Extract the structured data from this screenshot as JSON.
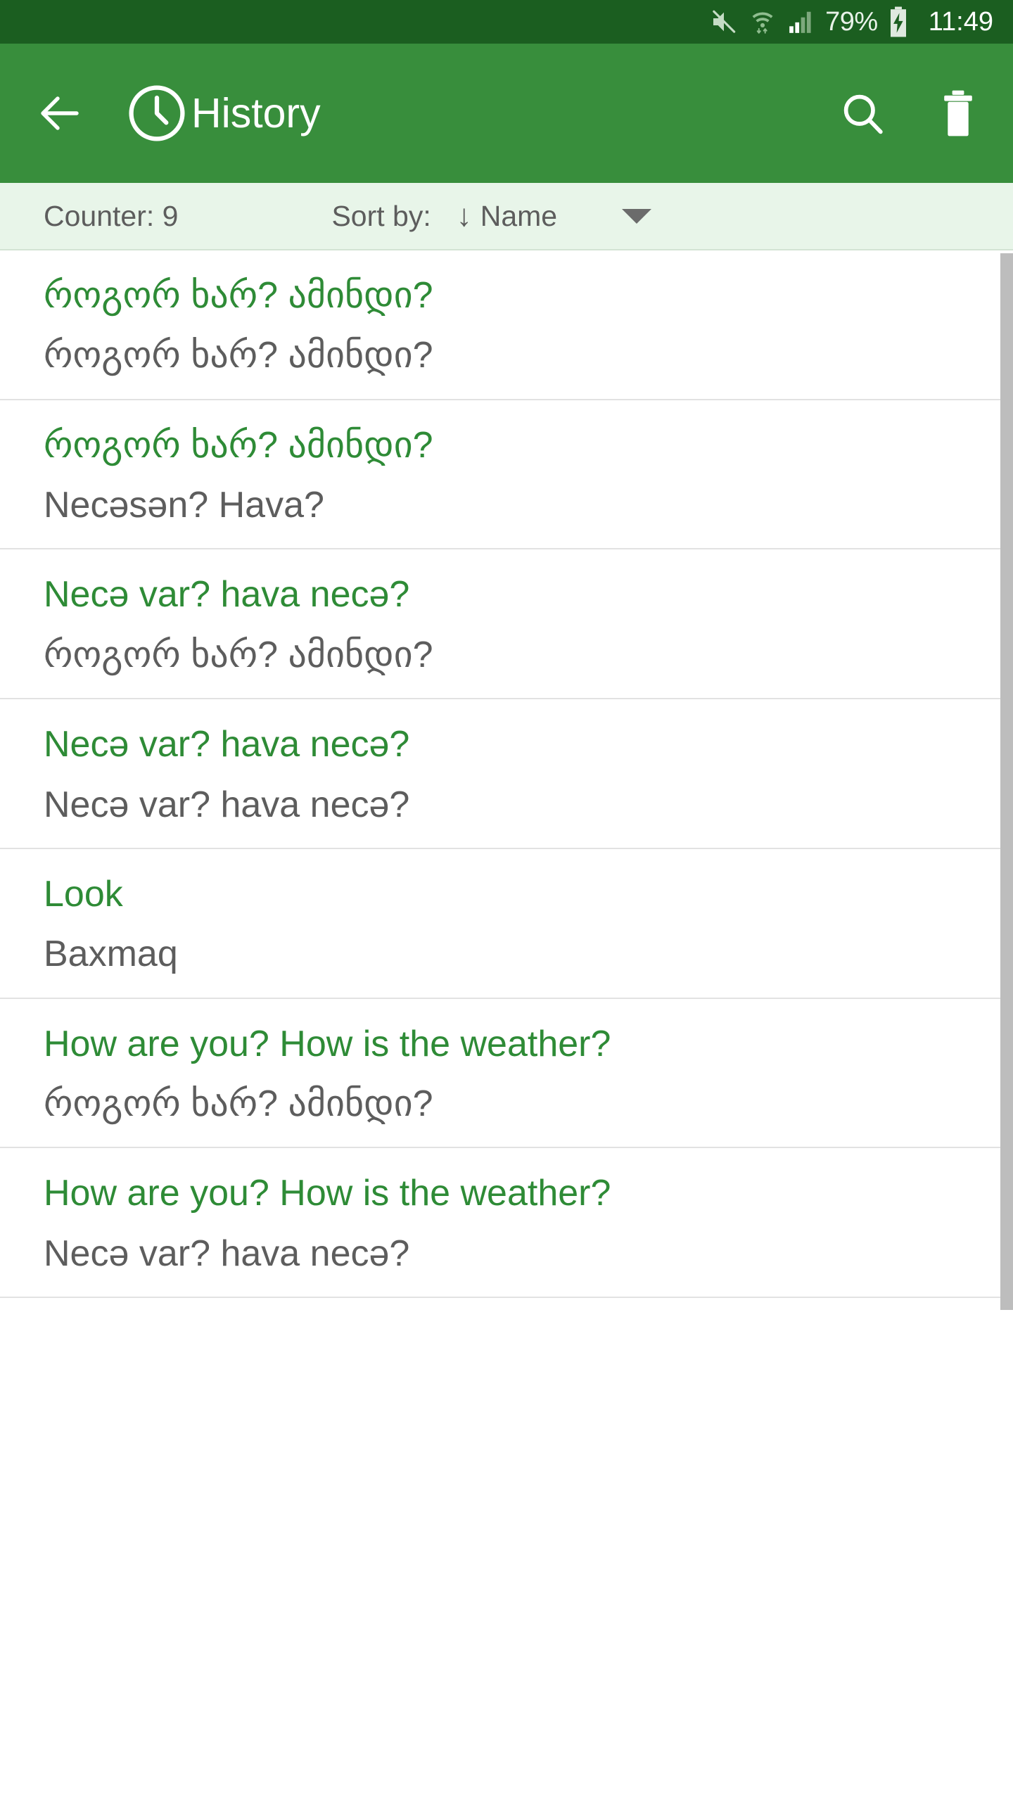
{
  "status_bar": {
    "mute_icon": "volume-mute-icon",
    "wifi_icon": "wifi-icon",
    "signal_icon": "cellular-signal-icon",
    "battery_percent": "79%",
    "battery_icon": "battery-charging-icon",
    "time": "11:49",
    "background_color": "#1b5e20"
  },
  "app_bar": {
    "back_icon": "arrow-left-icon",
    "clock_icon": "clock-icon",
    "title": "History",
    "search_icon": "search-icon",
    "delete_icon": "trash-icon",
    "background_color": "#388e3c"
  },
  "sort_bar": {
    "counter_label": "Counter: 9",
    "sort_by_label": "Sort by:",
    "sort_direction_arrow": "↓",
    "sort_value": "Name",
    "dropdown_icon": "chevron-down-icon",
    "background_color": "#e8f5e9"
  },
  "list": {
    "accent_color": "#2e8b36",
    "secondary_color": "#5d5d5d",
    "rows": [
      {
        "source": "როგორ ხარ? ამინდი?",
        "target": "როგორ ხარ? ამინდი?"
      },
      {
        "source": "როგორ ხარ? ამინდი?",
        "target": "Necəsən? Hava?"
      },
      {
        "source": "Necə var? hava necə?",
        "target": "როგორ ხარ? ამინდი?"
      },
      {
        "source": "Necə var? hava necə?",
        "target": "Necə var? hava necə?"
      },
      {
        "source": "Look",
        "target": "Baxmaq"
      },
      {
        "source": "How are you? How is the weather?",
        "target": "როგორ ხარ? ამინდი?"
      },
      {
        "source": "How are you? How is the weather?",
        "target": "Necə var? hava necə?"
      }
    ]
  },
  "scrollbar": {
    "name": "vertical-scrollbar",
    "color": "#bdbdbd"
  }
}
